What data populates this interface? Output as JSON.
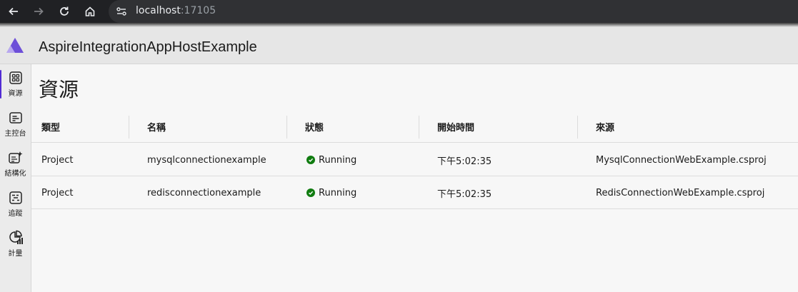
{
  "browser": {
    "url_host": "localhost",
    "url_port": ":17105"
  },
  "app": {
    "title": "AspireIntegrationAppHostExample",
    "accent": "#512bd4"
  },
  "sidebar": {
    "items": [
      {
        "label": "資源",
        "icon": "resources-grid-icon",
        "active": true
      },
      {
        "label": "主控台",
        "icon": "console-icon",
        "active": false
      },
      {
        "label": "結構化",
        "icon": "structured-logs-icon",
        "active": false
      },
      {
        "label": "追蹤",
        "icon": "traces-icon",
        "active": false
      },
      {
        "label": "計量",
        "icon": "metrics-icon",
        "active": false
      }
    ]
  },
  "main": {
    "title": "資源",
    "columns": [
      "類型",
      "名稱",
      "狀態",
      "開始時間",
      "來源"
    ],
    "rows": [
      {
        "type": "Project",
        "name": "mysqlconnectionexample",
        "state": "Running",
        "start": "下午5:02:35",
        "source": "MysqlConnectionWebExample.csproj"
      },
      {
        "type": "Project",
        "name": "redisconnectionexample",
        "state": "Running",
        "start": "下午5:02:35",
        "source": "RedisConnectionWebExample.csproj"
      }
    ],
    "status_color": "#107c10"
  }
}
